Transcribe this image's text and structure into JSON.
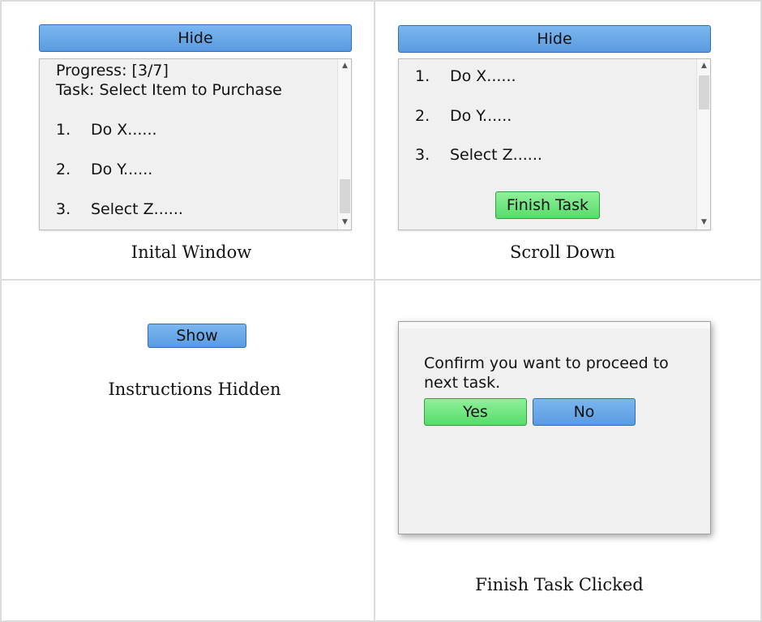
{
  "panels": {
    "initial": {
      "hide_label": "Hide",
      "progress": "Progress: [3/7]",
      "task": "Task: Select Item to Purchase",
      "items": [
        {
          "num": "1.",
          "text": "Do X......"
        },
        {
          "num": "2.",
          "text": "Do Y......"
        },
        {
          "num": "3.",
          "text": "Select Z......"
        }
      ],
      "caption": "Inital Window"
    },
    "scrolled": {
      "hide_label": "Hide",
      "items": [
        {
          "num": "1.",
          "text": "Do X......"
        },
        {
          "num": "2.",
          "text": "Do Y......"
        },
        {
          "num": "3.",
          "text": "Select Z......"
        }
      ],
      "finish_label": "Finish Task",
      "caption": "Scroll Down"
    },
    "hidden": {
      "show_label": "Show",
      "caption": "Instructions Hidden"
    },
    "confirm": {
      "message_line1": "Confirm you want to proceed to",
      "message_line2": "next task.",
      "yes_label": "Yes",
      "no_label": "No",
      "caption": "Finish Task Clicked"
    }
  },
  "colors": {
    "blue_button": "#5a9be0",
    "green_button": "#57dc6a",
    "panel_bg": "#f0f0f0"
  },
  "icons": {
    "scroll_up": "scroll-up-arrow-icon",
    "scroll_down": "scroll-down-arrow-icon"
  }
}
